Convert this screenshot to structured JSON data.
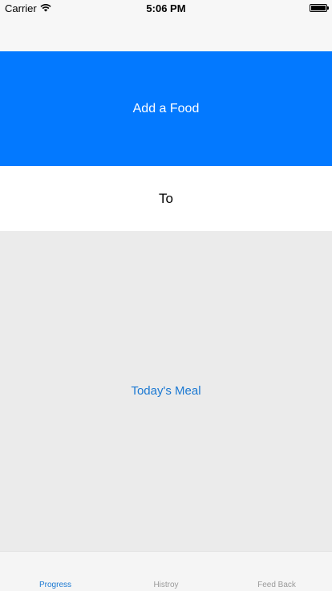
{
  "status_bar": {
    "carrier": "Carrier",
    "time": "5:06 PM",
    "battery_level": 1.0
  },
  "main": {
    "add_food_label": "Add a Food",
    "to_label": "To",
    "todays_meal_label": "Today's Meal"
  },
  "tab_bar": {
    "tabs": [
      {
        "label": "Progress",
        "active": true
      },
      {
        "label": "Histroy",
        "active": false
      },
      {
        "label": "Feed Back",
        "active": false
      }
    ]
  },
  "colors": {
    "primary_blue": "#0379ff",
    "link_blue": "#1a78d2",
    "meal_background": "#ebebeb",
    "tab_inactive": "#9a9a9a"
  }
}
